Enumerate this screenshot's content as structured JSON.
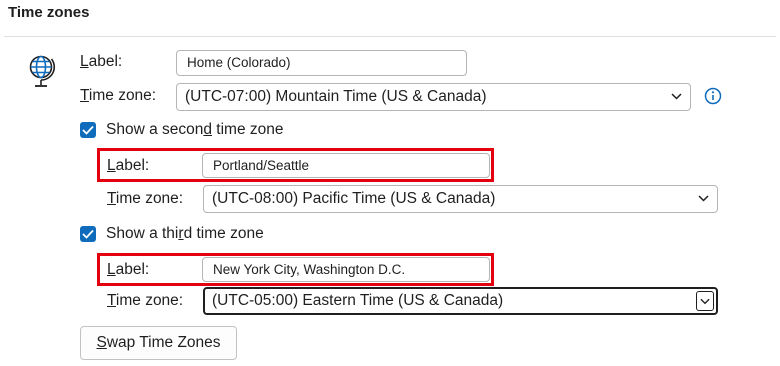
{
  "section": {
    "title": "Time zones"
  },
  "primary": {
    "label_caption": "abel:",
    "label_caption_mnemonic": "L",
    "label_value": "Home (Colorado)",
    "tz_caption": "ime zone:",
    "tz_caption_mnemonic": "T",
    "tz_value": "(UTC-07:00) Mountain Time (US & Canada)",
    "icon": "globe-icon",
    "info_icon": "info-icon"
  },
  "second": {
    "checkbox_prefix": "Show a secon",
    "checkbox_mnemonic": "d",
    "checkbox_suffix": " time zone",
    "checked": true,
    "label_caption": "abel:",
    "label_caption_mnemonic": "L",
    "label_value": "Portland/Seattle",
    "tz_caption": "ime zone:",
    "tz_caption_mnemonic": "T",
    "tz_value": "(UTC-08:00) Pacific Time (US & Canada)"
  },
  "third": {
    "checkbox_prefix": "Show a thi",
    "checkbox_mnemonic": "r",
    "checkbox_suffix": "d time zone",
    "checked": true,
    "label_caption": "abel:",
    "label_caption_mnemonic": "L",
    "label_value": "New York City, Washington D.C.",
    "tz_caption": "ime zone:",
    "tz_caption_mnemonic": "T",
    "tz_value": "(UTC-05:00) Eastern Time (US & Canada)"
  },
  "swap_button": {
    "mnemonic": "S",
    "rest": "wap Time Zones"
  },
  "colors": {
    "accent": "#0f6cbd",
    "highlight_box": "#e3000f",
    "text": "#1f1f1f",
    "border": "#b5b5b5"
  }
}
